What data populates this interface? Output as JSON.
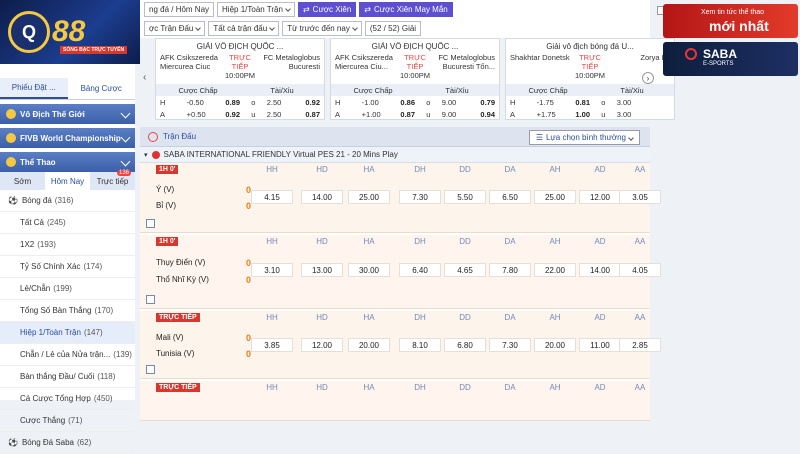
{
  "logo": {
    "text": "88",
    "tagline": "SÒNG BẠC TRỰC TUYẾN"
  },
  "topbar": {
    "row1": [
      "ng đá / Hôm Nay",
      "Hiệp 1/Toàn Trận",
      "Cược Xiên",
      "Cược Xiên May Mắn"
    ],
    "row2": [
      "ợc Trận Đấu",
      "Tất cả trận đấu",
      "Từ trước đến nay",
      "(52 / 52) Giải"
    ]
  },
  "sidebar": {
    "tabs": [
      "Phiếu Đặt ...",
      "Bảng Cược"
    ],
    "heads": [
      "Vô Địch Thế Giới",
      "FIVB World Championship",
      "Thể Thao"
    ],
    "subtabs": [
      "Sớm",
      "Hôm Nay",
      "Trực tiếp"
    ],
    "badge": "136",
    "items": [
      {
        "label": "Bóng đá",
        "count": "(316)"
      },
      {
        "label": "Tất Cả",
        "count": "(245)"
      },
      {
        "label": "1X2",
        "count": "(193)"
      },
      {
        "label": "Tỷ Số Chính Xác",
        "count": "(174)"
      },
      {
        "label": "Lẻ/Chẵn",
        "count": "(199)"
      },
      {
        "label": "Tổng Số Bàn Thắng",
        "count": "(170)"
      },
      {
        "label": "Hiệp 1/Toàn Trận",
        "count": "(147)"
      },
      {
        "label": "Chẵn / Lẻ của Nửa trận...",
        "count": "(139)"
      },
      {
        "label": "Bàn thắng Đầu/ Cuối",
        "count": "(118)"
      },
      {
        "label": "Cá Cược Tổng Hợp",
        "count": "(450)"
      },
      {
        "label": "Cược Thắng",
        "count": "(71)"
      },
      {
        "label": "Bóng Đá Saba",
        "count": "(62)"
      }
    ]
  },
  "cards": [
    {
      "league": "GIẢI VÔ ĐỊCH QUỐC ...",
      "home": "AFK Csikszereda Miercurea Ciuc",
      "status": "TRỰC TIẾP",
      "time": "10:00PM",
      "away": "FC Metaloglobus Bucuresti",
      "h1": "Cược Chấp",
      "h2": "Tài/Xỉu",
      "r1": [
        "H",
        "-0.50",
        "0.89",
        "o",
        "2.50",
        "0.92"
      ],
      "r2": [
        "A",
        "+0.50",
        "0.92",
        "u",
        "2.50",
        "0.87"
      ]
    },
    {
      "league": "GIẢI VÔ ĐỊCH QUỐC ...",
      "home": "AFK Csikszereda Miercurea Ciu...",
      "status": "TRỰC TIẾP",
      "time": "10:00PM",
      "away": "FC Metaloglobus Bucuresti Tốn...",
      "h1": "Cược Chấp",
      "h2": "Tài/Xỉu",
      "r1": [
        "H",
        "-1.00",
        "0.86",
        "o",
        "9.00",
        "0.79"
      ],
      "r2": [
        "A",
        "+1.00",
        "0.87",
        "u",
        "9.00",
        "0.94"
      ]
    },
    {
      "league": "Giải vô địch bóng đá U...",
      "home": "Shakhtar Donetsk",
      "status": "TRỰC TIẾP",
      "time": "10:00PM",
      "away": "Zorya Lu",
      "h1": "Cược Chấp",
      "h2": "Tài/Xỉu",
      "r1": [
        "H",
        "-1.75",
        "0.81",
        "o",
        "3.00",
        ""
      ],
      "r2": [
        "A",
        "+1.75",
        "1.00",
        "u",
        "3.00",
        ""
      ]
    }
  ],
  "main": {
    "title": "Trận Đấu",
    "sort": "Lựa chọn bình thường",
    "league": "SABA INTERNATIONAL FRIENDLY Virtual PES 21 - 20 Mins Play",
    "cols": [
      "HH",
      "HD",
      "HA",
      "DH",
      "DD",
      "DA",
      "AH",
      "AD",
      "AA"
    ],
    "matches": [
      {
        "tag": "1H 0'",
        "home": "Ý (V)",
        "away": "Bỉ (V)",
        "hs": "0",
        "as": "0",
        "odds": [
          "4.15",
          "14.00",
          "25.00",
          "7.30",
          "5.50",
          "6.50",
          "25.00",
          "12.00",
          "3.05"
        ]
      },
      {
        "tag": "1H 0'",
        "home": "Thụy Điển (V)",
        "away": "Thổ Nhĩ Kỳ (V)",
        "hs": "0",
        "as": "0",
        "odds": [
          "3.10",
          "13.00",
          "30.00",
          "6.40",
          "4.65",
          "7.80",
          "22.00",
          "14.00",
          "4.05"
        ]
      },
      {
        "tag": "TRỰC TIẾP",
        "home": "Mali (V)",
        "away": "Tunisia (V)",
        "hs": "0",
        "as": "0",
        "odds": [
          "3.85",
          "12.00",
          "20.00",
          "8.10",
          "6.80",
          "7.30",
          "20.00",
          "11.00",
          "2.85"
        ]
      },
      {
        "tag": "TRỰC TIẾP"
      }
    ]
  },
  "ads": [
    {
      "line1": "Xem tin tức thể thao",
      "line2": "mới nhất"
    },
    {
      "line1": "SABA",
      "line2": "E-SPORTS"
    }
  ]
}
